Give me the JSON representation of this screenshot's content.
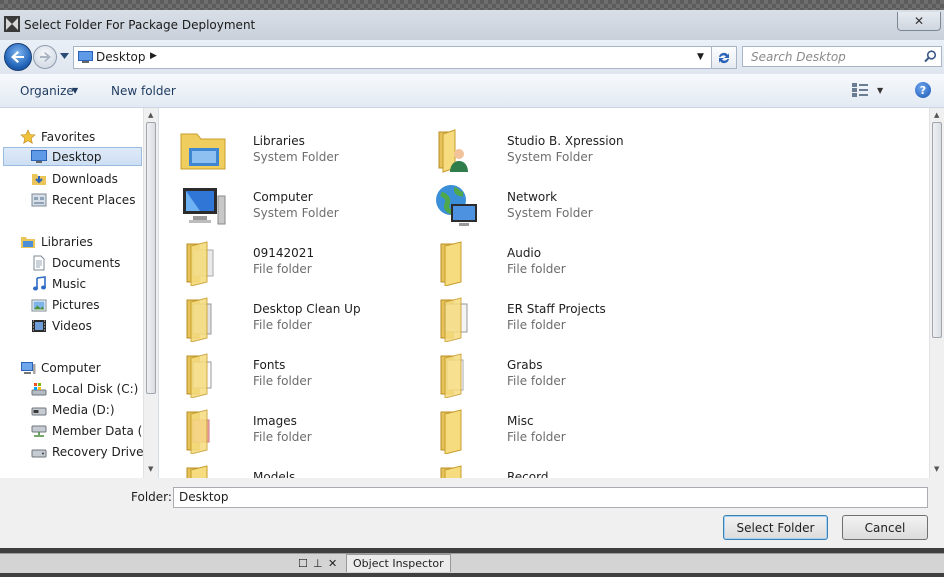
{
  "window": {
    "title": "Select Folder For Package Deployment",
    "close_glyph": "✕"
  },
  "navbar": {
    "address": "Desktop",
    "search_placeholder": "Search Desktop"
  },
  "toolbar": {
    "organize": "Organize",
    "new_folder": "New folder",
    "help": "?"
  },
  "nav": {
    "favorites": {
      "label": "Favorites",
      "items": [
        "Desktop",
        "Downloads",
        "Recent Places"
      ]
    },
    "libraries": {
      "label": "Libraries",
      "items": [
        "Documents",
        "Music",
        "Pictures",
        "Videos"
      ]
    },
    "computer": {
      "label": "Computer",
      "items": [
        "Local Disk (C:)",
        "Media (D:)",
        "Member Data (M",
        "Recovery Drive (F"
      ]
    }
  },
  "content": {
    "items": [
      {
        "name": "Libraries",
        "type": "System Folder",
        "icon": "libraries-icon"
      },
      {
        "name": "Studio B. Xpression",
        "type": "System Folder",
        "icon": "user-folder-icon"
      },
      {
        "name": "Computer",
        "type": "System Folder",
        "icon": "computer-icon"
      },
      {
        "name": "Network",
        "type": "System Folder",
        "icon": "network-icon"
      },
      {
        "name": "09142021",
        "type": "File folder",
        "icon": "folder-icon"
      },
      {
        "name": "Audio",
        "type": "File folder",
        "icon": "folder-icon"
      },
      {
        "name": "Desktop Clean Up",
        "type": "File folder",
        "icon": "folder-icon"
      },
      {
        "name": "ER Staff Projects",
        "type": "File folder",
        "icon": "folder-icon"
      },
      {
        "name": "Fonts",
        "type": "File folder",
        "icon": "folder-icon"
      },
      {
        "name": "Grabs",
        "type": "File folder",
        "icon": "folder-icon"
      },
      {
        "name": "Images",
        "type": "File folder",
        "icon": "folder-icon"
      },
      {
        "name": "Misc",
        "type": "File folder",
        "icon": "folder-icon"
      },
      {
        "name": "Models",
        "type": "",
        "icon": "folder-icon"
      },
      {
        "name": "Record",
        "type": "",
        "icon": "folder-icon"
      }
    ]
  },
  "footer": {
    "folder_label": "Folder:",
    "folder_value": "Desktop",
    "select_button": "Select Folder",
    "cancel_button": "Cancel"
  },
  "dock": {
    "tab_label": "Object Inspector"
  },
  "colors": {
    "accent": "#3c7fb1",
    "selection": "#cddff3",
    "folder": "#f2d36b"
  }
}
